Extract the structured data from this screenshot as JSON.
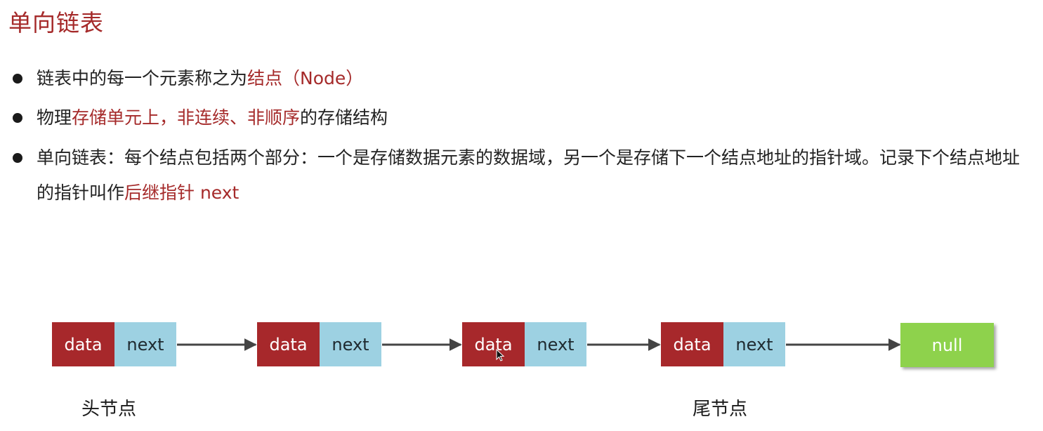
{
  "title": "单向链表",
  "bullets": [
    {
      "segments": [
        {
          "text": "链表中的每一个元素称之为",
          "hl": false
        },
        {
          "text": "结点（Node）",
          "hl": true
        }
      ]
    },
    {
      "segments": [
        {
          "text": "物理",
          "hl": false
        },
        {
          "text": "存储单元上，非连续、非顺序",
          "hl": true
        },
        {
          "text": "的存储结构",
          "hl": false
        }
      ]
    },
    {
      "segments": [
        {
          "text": "单向链表：每个结点包括两个部分：一个是存储数据元素的数据域，另一个是存储下一个结点地址的指针域。记录下个结点地址的指针叫作",
          "hl": false
        },
        {
          "text": "后继指针 next",
          "hl": true
        }
      ]
    }
  ],
  "nodes": [
    {
      "data_label": "data",
      "next_label": "next"
    },
    {
      "data_label": "data",
      "next_label": "next"
    },
    {
      "data_label": "data",
      "next_label": "next"
    },
    {
      "data_label": "data",
      "next_label": "next"
    }
  ],
  "null_label": "null",
  "head_label": "头节点",
  "tail_label": "尾节点",
  "colors": {
    "title": "#a52a2a",
    "data": "#a7282b",
    "next": "#9dd1e2",
    "null": "#8ed24c",
    "arrow": "#444444"
  }
}
